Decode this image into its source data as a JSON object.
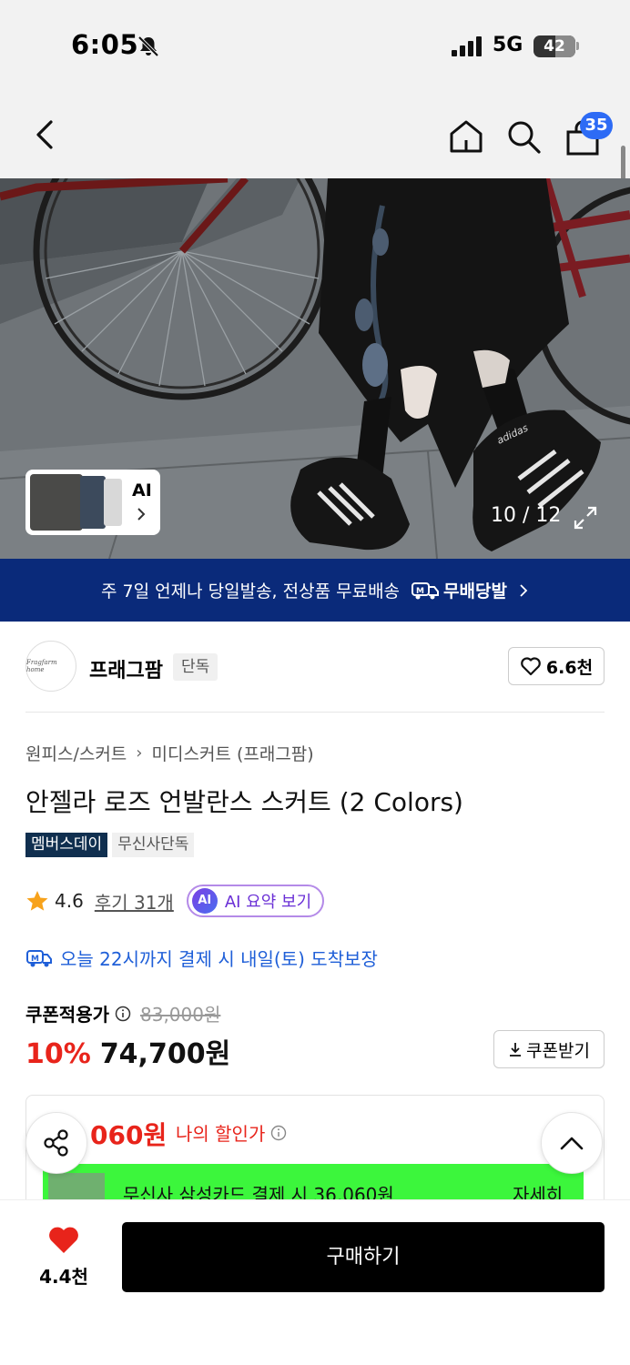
{
  "status_bar": {
    "time": "6:05",
    "network": "5G",
    "battery": "42"
  },
  "header": {
    "cart_count": "35"
  },
  "gallery": {
    "thumb_label": "AI",
    "page_indicator": "10 / 12"
  },
  "banner": {
    "text": "주 7일 언제나 당일발송, 전상품 무료배송",
    "badge": "무배당발"
  },
  "brand": {
    "logo_text": "Fragfarm home",
    "name": "프래그팜",
    "tag": "단독",
    "likes": "6.6천"
  },
  "product": {
    "breadcrumb": [
      "원피스/스커트",
      "미디스커트 (프래그팜)"
    ],
    "title": "안젤라 로즈 언발란스 스커트 (2 Colors)",
    "tags": [
      "멤버스데이",
      "무신사단독"
    ],
    "rating": "4.6",
    "reviews": "후기 31개",
    "ai_summary": "AI 요약 보기",
    "ai_badge": "AI",
    "delivery": "오늘 22시까지 결제 시 내일(토) 도착보장"
  },
  "price": {
    "coupon_label": "쿠폰적용가",
    "original": "83,000원",
    "discount": "10%",
    "final": "74,700원",
    "coupon_button": "쿠폰받기"
  },
  "my_price": {
    "amount": "060원",
    "label": "나의 할인가",
    "promo_text": "무신사 삼성카드 결제 시 36,060원",
    "promo_detail": "자세히"
  },
  "bottom_bar": {
    "wish_count": "4.4천",
    "buy_label": "구매하기"
  },
  "colors": {
    "accent_blue": "#2d6bf5",
    "banner_navy": "#0a2a7a",
    "sale_red": "#e8241b",
    "promo_green": "#3cf63c"
  }
}
